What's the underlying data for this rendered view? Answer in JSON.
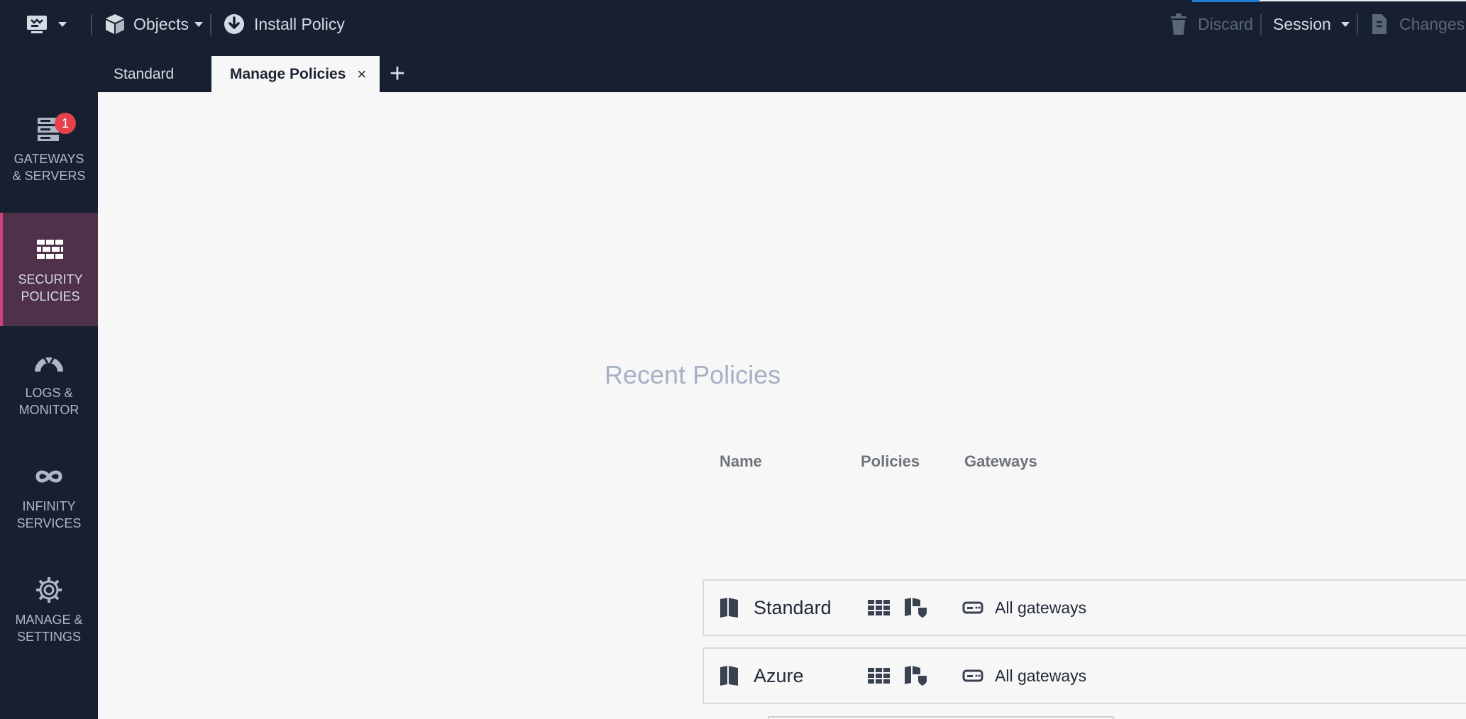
{
  "toolbar": {
    "menu_icon": "app-menu-icon",
    "objects_label": "Objects",
    "install_label": "Install Policy",
    "discard_label": "Discard",
    "session_label": "Session",
    "changes_label": "Changes"
  },
  "tabs": [
    {
      "label": "Standard"
    },
    {
      "label": "Manage Policies",
      "close": "×"
    }
  ],
  "tab_add": "+",
  "sidebar": {
    "badge": "1",
    "items": [
      {
        "line1": "GATEWAYS",
        "line2": "& SERVERS",
        "icon": "servers-icon"
      },
      {
        "line1": "SECURITY",
        "line2": "POLICIES",
        "icon": "firewall-icon"
      },
      {
        "line1": "LOGS &",
        "line2": "MONITOR",
        "icon": "gauge-icon"
      },
      {
        "line1": "INFINITY",
        "line2": "SERVICES",
        "icon": "infinity-icon"
      },
      {
        "line1": "MANAGE &",
        "line2": "SETTINGS",
        "icon": "gear-icon"
      }
    ]
  },
  "recent": {
    "title": "Recent Policies",
    "columns": {
      "name": "Name",
      "policies": "Policies",
      "gateways": "Gateways"
    },
    "rows": [
      {
        "name": "Standard",
        "gateways": "All gateways"
      },
      {
        "name": "Azure",
        "gateways": "All gateways"
      }
    ]
  },
  "colors": {
    "accent": "#d4417a",
    "badge": "#e5424b",
    "title": "#a5b1c4",
    "toolbar_bg": "#172030"
  }
}
